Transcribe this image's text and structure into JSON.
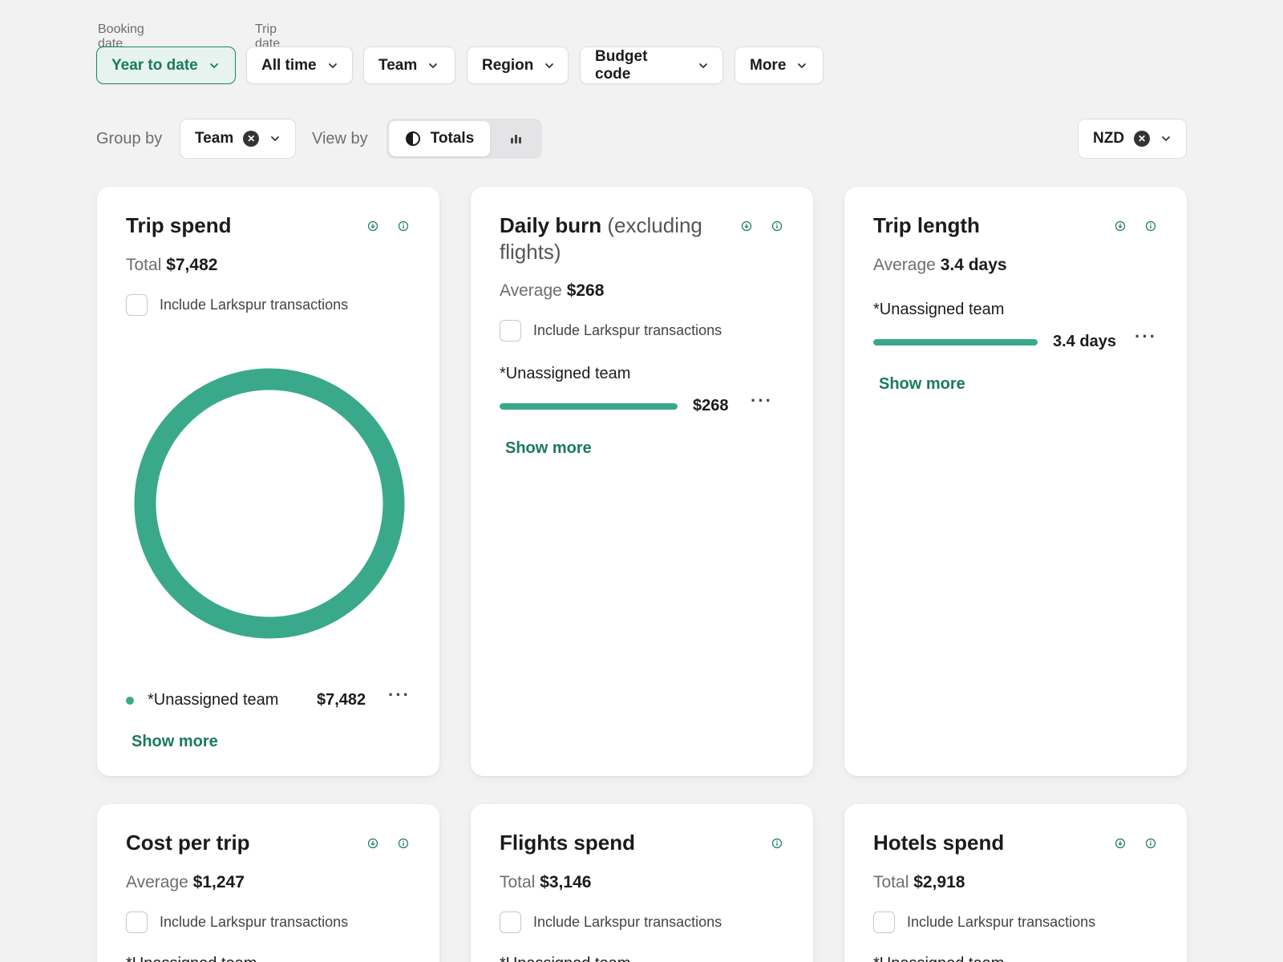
{
  "filters": {
    "booking_date_label": "Booking date",
    "trip_date_label": "Trip date",
    "year_to_date": "Year to date",
    "all_time": "All time",
    "team": "Team",
    "region": "Region",
    "budget_code": "Budget code",
    "more": "More"
  },
  "groupbar": {
    "group_by_label": "Group by",
    "group_value": "Team",
    "view_by_label": "View by",
    "totals": "Totals",
    "currency": "NZD"
  },
  "colors": {
    "accent": "#3aa98b",
    "accent_dark": "#1a7a5c"
  },
  "cards": {
    "trip_spend": {
      "title": "Trip spend",
      "stat_label": "Total",
      "stat_value": "$7,482",
      "checkbox": "Include Larkspur transactions",
      "legend_label": "*Unassigned team",
      "legend_value": "$7,482",
      "show_more": "Show more"
    },
    "daily_burn": {
      "title": "Daily burn",
      "title_suffix": "(excluding flights)",
      "stat_label": "Average",
      "stat_value": "$268",
      "checkbox": "Include Larkspur transactions",
      "row_label": "*Unassigned team",
      "row_value": "$268",
      "row_fill": 1.0,
      "show_more": "Show more"
    },
    "trip_length": {
      "title": "Trip length",
      "stat_label": "Average",
      "stat_value": "3.4 days",
      "row_label": "*Unassigned team",
      "row_value": "3.4 days",
      "row_fill": 1.0,
      "show_more": "Show more"
    },
    "cost_per_trip": {
      "title": "Cost per trip",
      "stat_label": "Average",
      "stat_value": "$1,247",
      "checkbox": "Include Larkspur transactions",
      "row_label": "*Unassigned team"
    },
    "flights_spend": {
      "title": "Flights spend",
      "stat_label": "Total",
      "stat_value": "$3,146",
      "checkbox": "Include Larkspur transactions",
      "row_label": "*Unassigned team"
    },
    "hotels_spend": {
      "title": "Hotels spend",
      "stat_label": "Total",
      "stat_value": "$2,918",
      "checkbox": "Include Larkspur transactions",
      "row_label": "*Unassigned team"
    }
  },
  "chart_data": {
    "type": "pie",
    "categories": [
      "*Unassigned team"
    ],
    "values": [
      7482
    ]
  }
}
